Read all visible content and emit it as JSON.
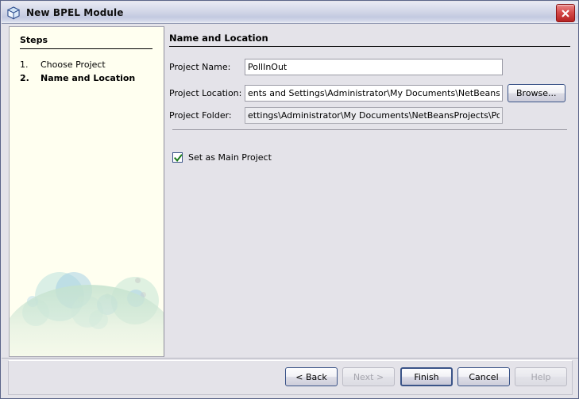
{
  "window": {
    "title": "New BPEL Module",
    "icon": "cube-icon",
    "close_label": "Close",
    "accent_color": "#3b5488",
    "title_gradient_color": "#c2c9e0",
    "close_button_color": "#c62f2f"
  },
  "sidebar": {
    "heading": "Steps",
    "background_color": "#fffff0",
    "steps": [
      {
        "number": "1.",
        "label": "Choose Project",
        "current": false
      },
      {
        "number": "2.",
        "label": "Name and Location",
        "current": true
      }
    ]
  },
  "main": {
    "heading": "Name and Location",
    "fields": [
      {
        "label": "Project Name:",
        "value": "PollInOut",
        "placeholder": "",
        "readonly": false
      },
      {
        "label": "Project Location:",
        "value": "ents and Settings\\Administrator\\My Documents\\NetBeansProjects",
        "placeholder": "",
        "readonly": false
      },
      {
        "label": "Project Folder:",
        "value": "ettings\\Administrator\\My Documents\\NetBeansProjects\\PollInOut",
        "placeholder": "",
        "readonly": true
      }
    ],
    "browse_label": "Browse...",
    "checkbox": {
      "label": "Set as Main Project",
      "checked": true,
      "check_color": "#1a7a1a"
    }
  },
  "buttons": [
    {
      "label": "< Back",
      "disabled": false,
      "default": false
    },
    {
      "label": "Next >",
      "disabled": true,
      "default": false
    },
    {
      "label": "Finish",
      "disabled": false,
      "default": true
    },
    {
      "label": "Cancel",
      "disabled": false,
      "default": false
    },
    {
      "label": "Help",
      "disabled": true,
      "default": false
    }
  ]
}
